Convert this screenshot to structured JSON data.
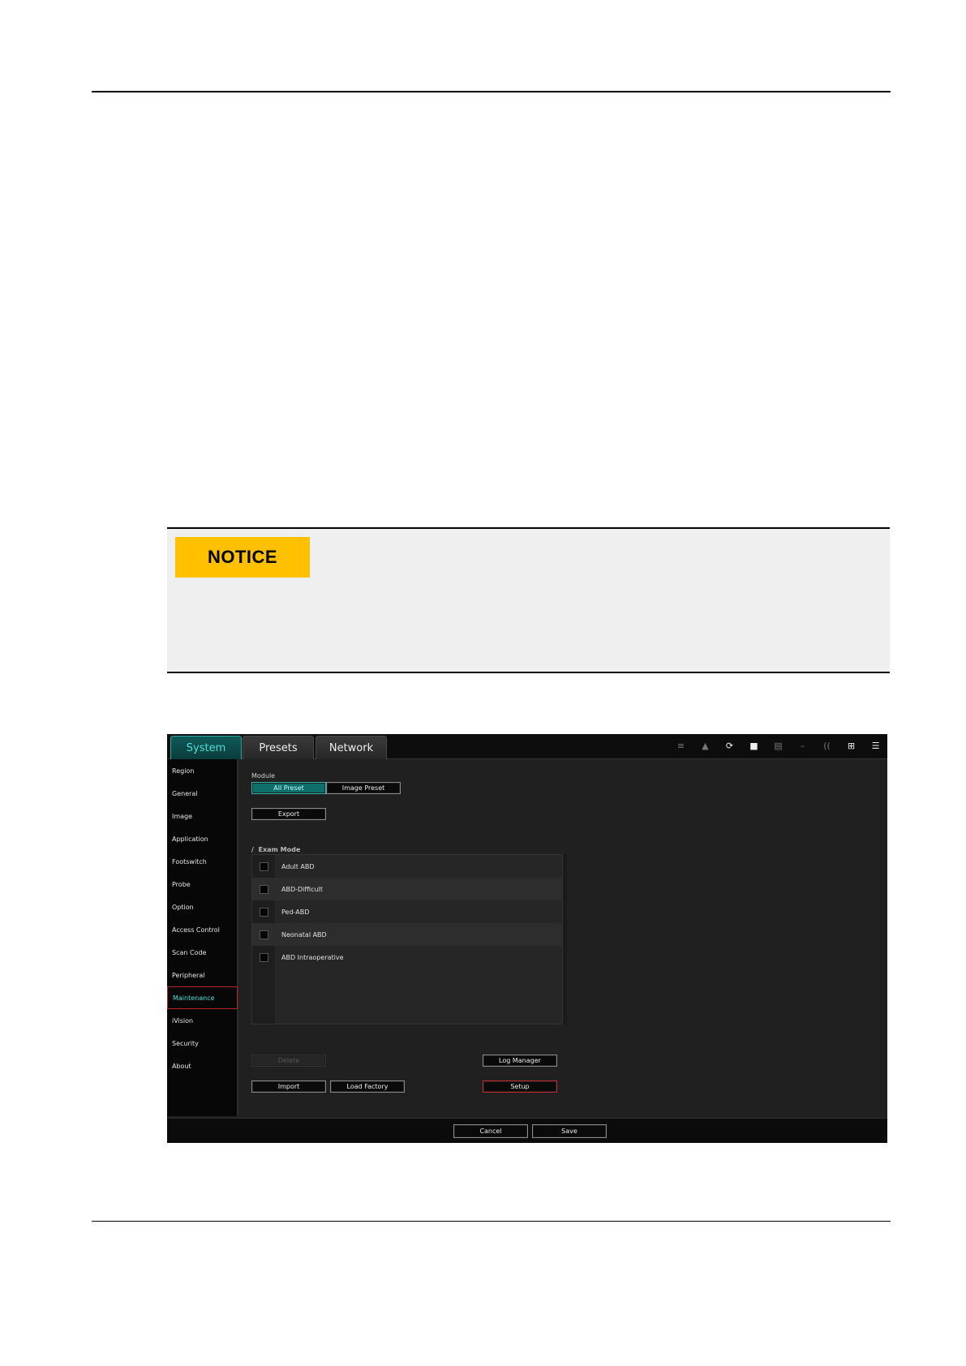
{
  "notice": {
    "tag": "NOTICE"
  },
  "tabs": [
    "System",
    "Presets",
    "Network"
  ],
  "top_icons": [
    "list-icon",
    "tree-icon",
    "refresh-icon",
    "video-icon",
    "printer-icon",
    "cable-icon",
    "wireless-icon",
    "network-icon",
    "menu-icon"
  ],
  "sidebar": {
    "items": [
      "Region",
      "General",
      "Image",
      "Application",
      "Footswitch",
      "Probe",
      "Option",
      "Access Control",
      "Scan Code",
      "Peripheral",
      "Maintenance",
      "iVision",
      "Security",
      "About"
    ],
    "selected": "Maintenance"
  },
  "module": {
    "label": "Module",
    "options": [
      "All Preset",
      "Image Preset"
    ],
    "selected": "All Preset"
  },
  "export_button": "Export",
  "exam_mode": {
    "title": "Exam Mode",
    "items": [
      "Adult ABD",
      "ABD-Difficult",
      "Ped-ABD",
      "Neonatal ABD",
      "ABD Intraoperative"
    ]
  },
  "buttons": {
    "disabled_label": "Delete",
    "log_manager": "Log Manager",
    "import": "Import",
    "load_factory": "Load Factory",
    "setup": "Setup"
  },
  "footer": {
    "cancel": "Cancel",
    "save": "Save"
  },
  "colors": {
    "accent": "#49e1dc",
    "highlight": "#c42a33",
    "notice_yellow": "#ffc000"
  }
}
